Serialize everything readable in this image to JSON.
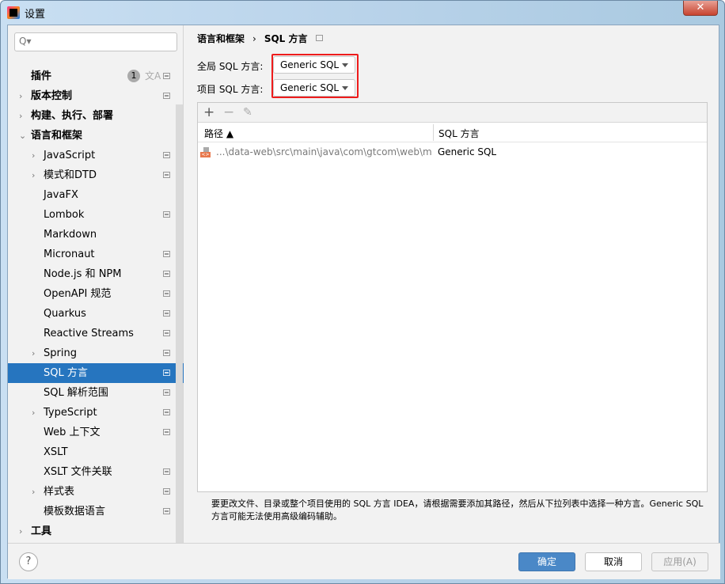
{
  "window": {
    "title": "设置",
    "close": "✕"
  },
  "search": {
    "placeholder": "Q▾"
  },
  "sidebar": {
    "items": [
      {
        "label": "插件",
        "level": 0,
        "arrow": "",
        "badge": "1",
        "translate": "文A",
        "cfg": true
      },
      {
        "label": "版本控制",
        "level": 0,
        "arrow": "›",
        "cfg": true
      },
      {
        "label": "构建、执行、部署",
        "level": 0,
        "arrow": "›",
        "cfg": false
      },
      {
        "label": "语言和框架",
        "level": 0,
        "arrow": "⌄",
        "cfg": false
      },
      {
        "label": "JavaScript",
        "level": 1,
        "arrow": "›",
        "cfg": true
      },
      {
        "label": "模式和DTD",
        "level": 1,
        "arrow": "›",
        "cfg": true
      },
      {
        "label": "JavaFX",
        "level": 1,
        "arrow": "",
        "cfg": false
      },
      {
        "label": "Lombok",
        "level": 1,
        "arrow": "",
        "cfg": true
      },
      {
        "label": "Markdown",
        "level": 1,
        "arrow": "",
        "cfg": false
      },
      {
        "label": "Micronaut",
        "level": 1,
        "arrow": "",
        "cfg": true
      },
      {
        "label": "Node.js 和 NPM",
        "level": 1,
        "arrow": "",
        "cfg": true
      },
      {
        "label": "OpenAPI 规范",
        "level": 1,
        "arrow": "",
        "cfg": true
      },
      {
        "label": "Quarkus",
        "level": 1,
        "arrow": "",
        "cfg": true
      },
      {
        "label": "Reactive Streams",
        "level": 1,
        "arrow": "",
        "cfg": true
      },
      {
        "label": "Spring",
        "level": 1,
        "arrow": "›",
        "cfg": true
      },
      {
        "label": "SQL 方言",
        "level": 1,
        "arrow": "",
        "cfg": true,
        "selected": true
      },
      {
        "label": "SQL 解析范围",
        "level": 1,
        "arrow": "",
        "cfg": true
      },
      {
        "label": "TypeScript",
        "level": 1,
        "arrow": "›",
        "cfg": true
      },
      {
        "label": "Web 上下文",
        "level": 1,
        "arrow": "",
        "cfg": true
      },
      {
        "label": "XSLT",
        "level": 1,
        "arrow": "",
        "cfg": false
      },
      {
        "label": "XSLT 文件关联",
        "level": 1,
        "arrow": "",
        "cfg": true
      },
      {
        "label": "样式表",
        "level": 1,
        "arrow": "›",
        "cfg": true
      },
      {
        "label": "模板数据语言",
        "level": 1,
        "arrow": "",
        "cfg": true
      },
      {
        "label": "工具",
        "level": 0,
        "arrow": "›",
        "cfg": false
      }
    ]
  },
  "breadcrumb": {
    "parent": "语言和框架",
    "sep": "›",
    "current": "SQL 方言"
  },
  "global_dialect": {
    "label": "全局 SQL 方言:",
    "value": "Generic SQL"
  },
  "project_dialect": {
    "label": "项目 SQL 方言:",
    "value": "Generic SQL"
  },
  "toolbar": {
    "add": "+",
    "remove": "−",
    "edit": "✎"
  },
  "table": {
    "columns": [
      "路径 ▲",
      "SQL 方言"
    ],
    "rows": [
      {
        "path": "...\\data-web\\src\\main\\java\\com\\gtcom\\web\\ma",
        "dialect": "Generic SQL"
      }
    ]
  },
  "note": "要更改文件、目录或整个项目使用的 SQL 方言 IDEA，请根据需要添加其路径，然后从下拉列表中选择一种方言。Generic SQL 方言可能无法使用高级编码辅助。",
  "footer": {
    "help": "?",
    "ok": "确定",
    "cancel": "取消",
    "apply": "应用(A)"
  },
  "colors": {
    "selection": "#2675bf",
    "ok_button": "#4a88c7",
    "highlight": "#ee1c1c"
  }
}
